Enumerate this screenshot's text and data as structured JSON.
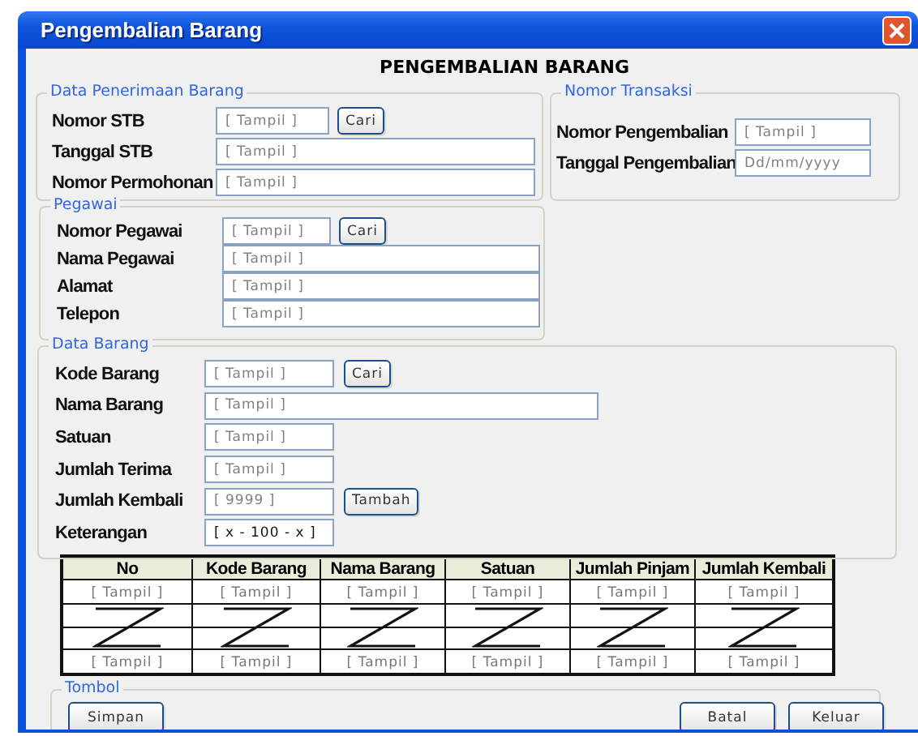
{
  "window": {
    "title": "Pengembalian Barang"
  },
  "heading": "PENGEMBALIAN BARANG",
  "top_groups": [
    {
      "title": "Data Penerimaan Barang",
      "fields": [
        {
          "label": "Nomor STB",
          "kind": "short",
          "placeholder": "[ Tampil ]",
          "button": "Cari"
        },
        {
          "label": "Tanggal STB",
          "kind": "long",
          "placeholder": "[ Tampil ]"
        },
        {
          "label": "Nomor Permohonan",
          "kind": "long",
          "placeholder": "[ Tampil ]"
        }
      ]
    },
    {
      "title": "Nomor Transaksi",
      "fields": [
        {
          "label": "Nomor Pengembalian",
          "kind": "short",
          "placeholder": "[ Tampil ]"
        },
        {
          "label": "Tanggal Pengembalian",
          "kind": "short",
          "placeholder": "Dd/mm/yyyy"
        }
      ]
    }
  ],
  "groups": [
    {
      "title": "Pegawai",
      "fields": [
        {
          "label": "Nomor Pegawai",
          "kind": "short",
          "placeholder": "[ Tampil ]",
          "button": "Cari"
        },
        {
          "label": "Nama Pegawai",
          "kind": "long",
          "placeholder": "[ Tampil ]"
        },
        {
          "label": "Alamat",
          "kind": "long",
          "placeholder": "[ Tampil ]"
        },
        {
          "label": "Telepon",
          "kind": "long",
          "placeholder": "[ Tampil ]"
        }
      ]
    },
    {
      "title": "Data Barang",
      "fields": [
        {
          "label": "Kode Barang",
          "kind": "short",
          "placeholder": "[ Tampil ]",
          "button": "Cari"
        },
        {
          "label": "Nama Barang",
          "kind": "long",
          "placeholder": "[ Tampil ]"
        },
        {
          "label": "Satuan",
          "kind": "short",
          "placeholder": "[ Tampil ]"
        },
        {
          "label": "Jumlah Terima",
          "kind": "short",
          "placeholder": "[ Tampil ]"
        },
        {
          "label": "Jumlah Kembali",
          "kind": "short",
          "placeholder": "[ 9999 ]",
          "button": "Tambah"
        },
        {
          "label": "Keterangan",
          "kind": "short",
          "value": "[ x - 100 - x ]"
        }
      ]
    }
  ],
  "table": {
    "columns": [
      "No",
      "Kode Barang",
      "Nama Barang",
      "Satuan",
      "Jumlah Pinjam",
      "Jumlah Kembali"
    ],
    "rows": [
      {
        "kind": "text",
        "cells": [
          "[ Tampil ]",
          "[ Tampil ]",
          "[ Tampil ]",
          "[ Tampil ]",
          "[ Tampil ]",
          "[ Tampil ]"
        ]
      },
      {
        "kind": "continued"
      },
      {
        "kind": "text",
        "cells": [
          "[ Tampil ]",
          "[ Tampil ]",
          "[ Tampil ]",
          "[ Tampil ]",
          "[ Tampil ]",
          "[ Tampil ]"
        ]
      }
    ]
  },
  "buttons_group": {
    "title": "Tombol",
    "left": [
      "Simpan"
    ],
    "right": [
      "Batal",
      "Keluar"
    ]
  }
}
